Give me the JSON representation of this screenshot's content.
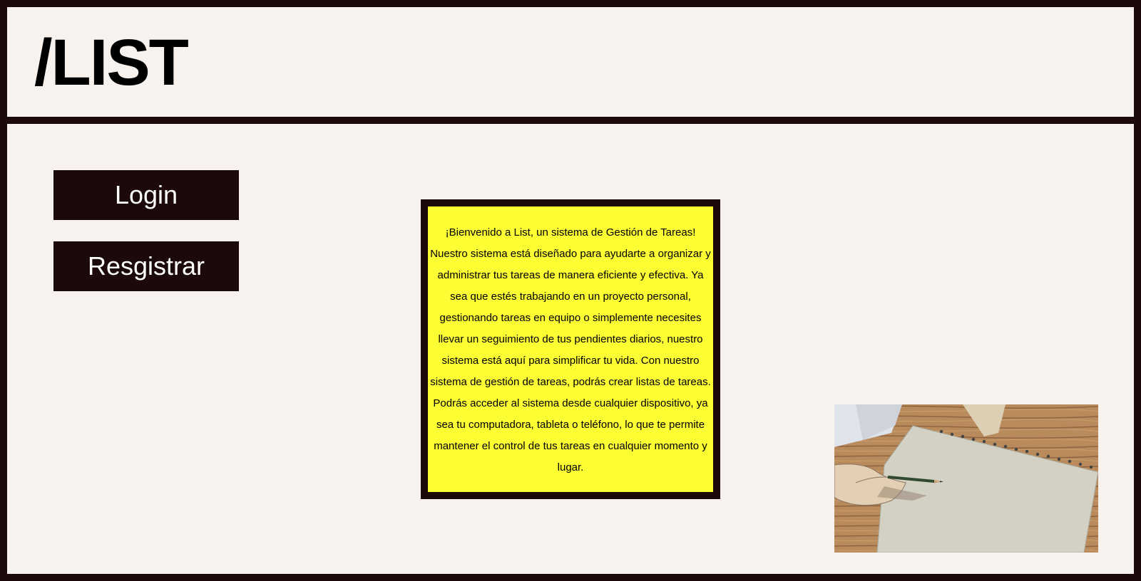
{
  "header": {
    "logo": "/LIST"
  },
  "nav": {
    "login_label": "Login",
    "register_label": "Resgistrar"
  },
  "welcome": {
    "text": "¡Bienvenido a List, un sistema de Gestión de Tareas! Nuestro sistema está diseñado para ayudarte a organizar y administrar tus tareas de manera eficiente y efectiva. Ya sea que estés trabajando en un proyecto personal, gestionando tareas en equipo o simplemente necesites llevar un seguimiento de tus pendientes diarios, nuestro sistema está aquí para simplificar tu vida. Con nuestro sistema de gestión de tareas, podrás crear listas de tareas. Podrás acceder al sistema desde cualquier dispositivo, ya sea tu computadora, tableta o teléfono, lo que te permite mantener el control de tus tareas en cualquier momento y lugar."
  },
  "colors": {
    "frame": "#1c0a0a",
    "panel": "#f7f2ee",
    "highlight": "#fdfd33"
  },
  "image": {
    "subject": "illustration-hand-drawing-sketchbook"
  }
}
